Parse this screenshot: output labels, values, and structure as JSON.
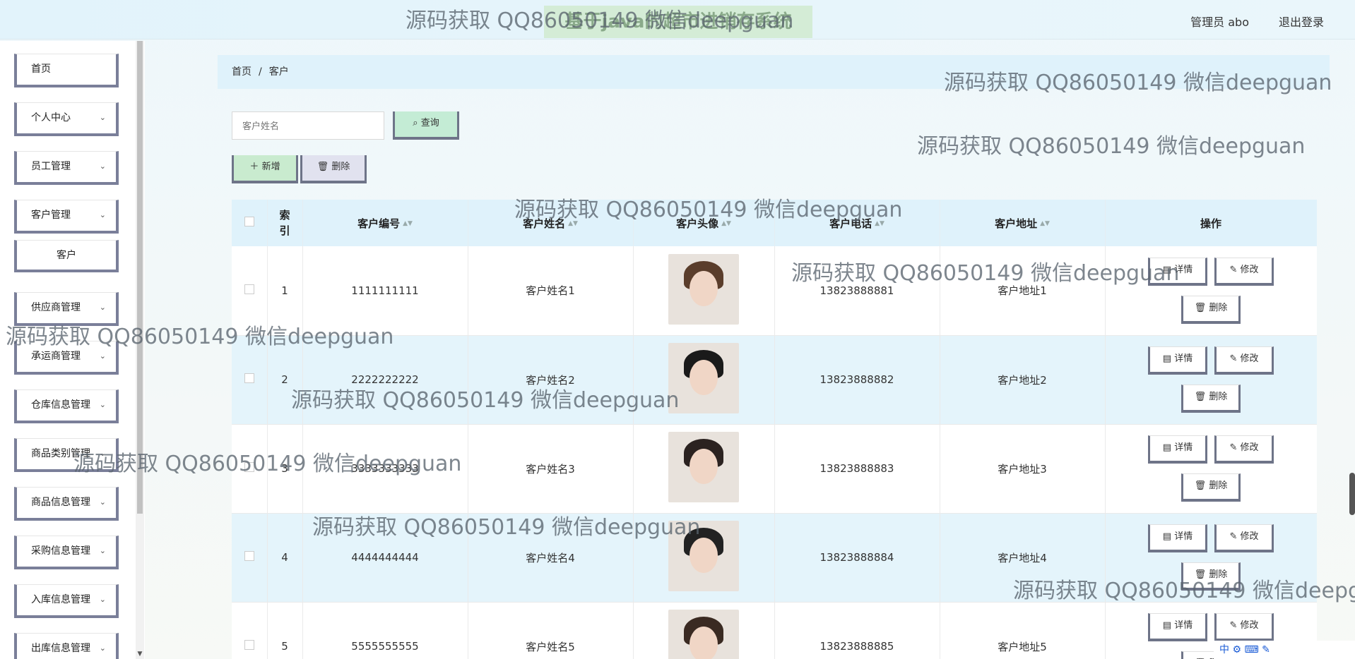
{
  "header": {
    "site_title": "基于java的超市进销存系统",
    "admin_label": "管理员 abo",
    "logout_label": "退出登录"
  },
  "sidebar": {
    "items": [
      {
        "label": "首页",
        "expandable": false
      },
      {
        "label": "个人中心",
        "expandable": true
      },
      {
        "label": "员工管理",
        "expandable": true
      },
      {
        "label": "客户管理",
        "expandable": true
      },
      {
        "label": "客户",
        "expandable": false,
        "sub": true
      },
      {
        "label": "供应商管理",
        "expandable": true
      },
      {
        "label": "承运商管理",
        "expandable": true
      },
      {
        "label": "仓库信息管理",
        "expandable": true
      },
      {
        "label": "商品类别管理",
        "expandable": true
      },
      {
        "label": "商品信息管理",
        "expandable": true
      },
      {
        "label": "采购信息管理",
        "expandable": true
      },
      {
        "label": "入库信息管理",
        "expandable": true
      },
      {
        "label": "出库信息管理",
        "expandable": true
      }
    ]
  },
  "breadcrumb": {
    "home": "首页",
    "separator": "/",
    "current": "客户"
  },
  "search": {
    "placeholder": "客户姓名",
    "button_label": "查询"
  },
  "actions": {
    "add_label": "新增",
    "delete_label": "删除"
  },
  "table": {
    "headers": [
      "索引",
      "客户编号",
      "客户姓名",
      "客户头像",
      "客户电话",
      "客户地址",
      "操作"
    ],
    "rows": [
      {
        "index": "1",
        "code": "1111111111",
        "name": "客户姓名1",
        "phone": "13823888881",
        "address": "客户地址1"
      },
      {
        "index": "2",
        "code": "2222222222",
        "name": "客户姓名2",
        "phone": "13823888882",
        "address": "客户地址2"
      },
      {
        "index": "3",
        "code": "3333333333",
        "name": "客户姓名3",
        "phone": "13823888883",
        "address": "客户地址3"
      },
      {
        "index": "4",
        "code": "4444444444",
        "name": "客户姓名4",
        "phone": "13823888884",
        "address": "客户地址4"
      },
      {
        "index": "5",
        "code": "5555555555",
        "name": "客户姓名5",
        "phone": "13823888885",
        "address": "客户地址5"
      }
    ],
    "op_labels": {
      "detail": "详情",
      "edit": "修改",
      "delete": "删除"
    }
  },
  "watermark": "源码获取 QQ86050149 微信deepguan",
  "ime": {
    "label": "中"
  },
  "colors": {
    "header_bg": "#dff2fb",
    "row_alt": "#e4f4fb",
    "btn_border": "#6e7488",
    "search_btn": "#c4ecd5"
  }
}
